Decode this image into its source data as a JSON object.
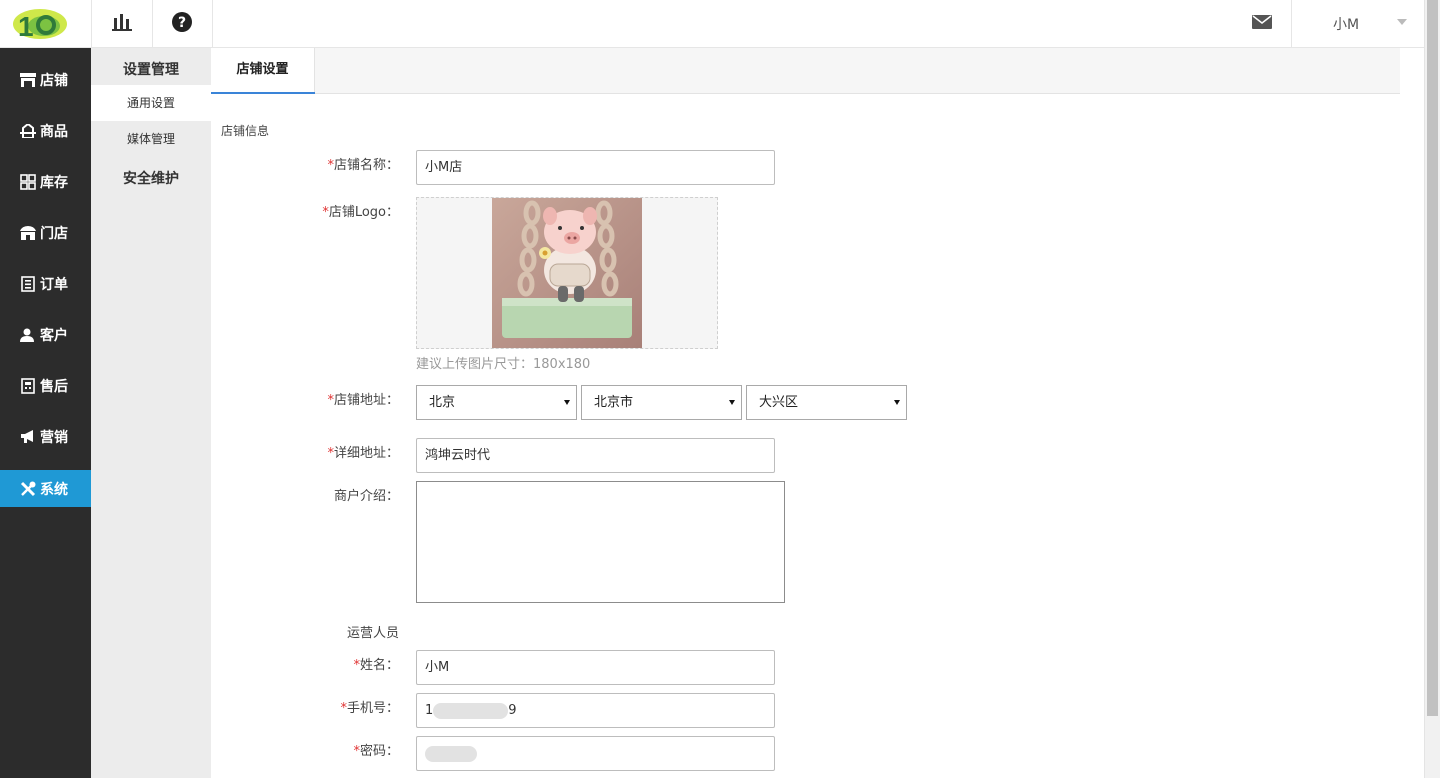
{
  "topbar": {
    "user_name": "小M"
  },
  "icons": {
    "logo": "logo",
    "chart": "bar-chart-icon",
    "help": "question-circle-icon",
    "mail": "mail-icon",
    "caret": "caret-down-icon"
  },
  "leftnav": {
    "items": [
      {
        "label": "店铺",
        "icon": "store-icon"
      },
      {
        "label": "商品",
        "icon": "goods-icon"
      },
      {
        "label": "库存",
        "icon": "grid-icon"
      },
      {
        "label": "门店",
        "icon": "shop-icon"
      },
      {
        "label": "订单",
        "icon": "order-icon"
      },
      {
        "label": "客户",
        "icon": "user-icon"
      },
      {
        "label": "售后",
        "icon": "service-icon"
      },
      {
        "label": "营销",
        "icon": "megaphone-icon"
      },
      {
        "label": "系统",
        "icon": "tools-icon"
      }
    ],
    "active": "系统"
  },
  "subnav": {
    "group1": "设置管理",
    "items": [
      "通用设置",
      "媒体管理"
    ],
    "group2": "安全维护"
  },
  "tabs": {
    "active": "店铺设置"
  },
  "form": {
    "section_title": "店铺信息",
    "store_name_label": "店铺名称：",
    "store_name_value": "小M店",
    "logo_label": "店铺Logo：",
    "logo_hint": "建议上传图片尺寸：180x180",
    "address_label": "店铺地址：",
    "province": "北京",
    "city": "北京市",
    "district": "大兴区",
    "detail_label": "详细地址：",
    "detail_value": "鸿坤云时代",
    "intro_label": "商户介绍：",
    "intro_value": "",
    "operator_title": "运营人员",
    "name_label": "姓名：",
    "name_value": "小M",
    "phone_label": "手机号：",
    "phone_prefix": "1",
    "phone_suffix": "9",
    "password_label": "密码："
  },
  "colors": {
    "nav_bg": "#2c2c2c",
    "nav_active": "#1f99d5",
    "required": "#e03232",
    "tab_underline": "#3a84d8"
  }
}
